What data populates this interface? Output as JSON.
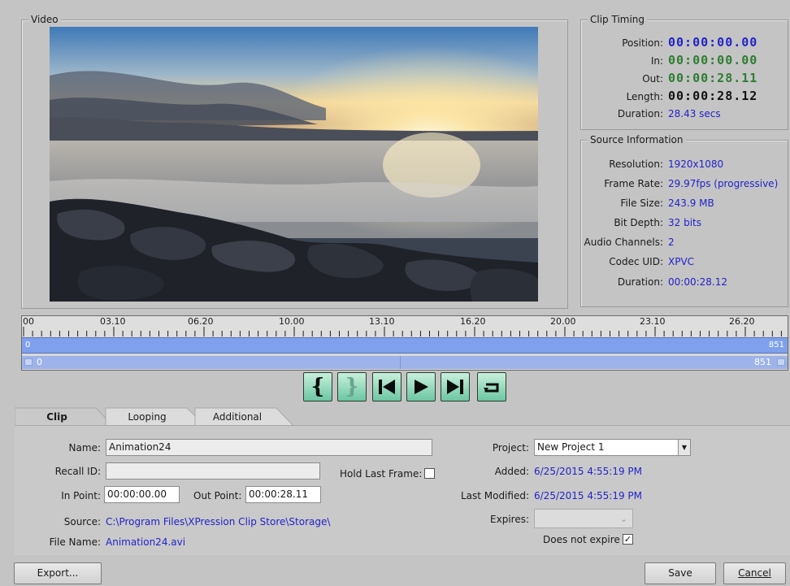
{
  "video": {
    "legend": "Video"
  },
  "clip_timing": {
    "legend": "Clip Timing",
    "position_label": "Position:",
    "position": "00:00:00.00",
    "in_label": "In:",
    "in": "00:00:00.00",
    "out_label": "Out:",
    "out": "00:00:28.11",
    "length_label": "Length:",
    "length": "00:00:28.12",
    "duration_label": "Duration:",
    "duration": "28.43 secs"
  },
  "source_info": {
    "legend": "Source Information",
    "resolution_label": "Resolution:",
    "resolution": "1920x1080",
    "frame_rate_label": "Frame Rate:",
    "frame_rate": "29.97fps (progressive)",
    "file_size_label": "File Size:",
    "file_size": "243.9 MB",
    "bit_depth_label": "Bit Depth:",
    "bit_depth": "32 bits",
    "audio_channels_label": "Audio Channels:",
    "audio_channels": "2",
    "codec_label": "Codec UID:",
    "codec": "XPVC",
    "duration_label": "Duration:",
    "duration": "00:00:28.12"
  },
  "timeline": {
    "ruler_labels": [
      "00",
      "03.10",
      "06.20",
      "10.00",
      "13.10",
      "16.20",
      "20.00",
      "23.10",
      "26.20"
    ],
    "range_start": "0",
    "range_end": "851",
    "scroll_start": "0",
    "scroll_end": "851"
  },
  "transport": {
    "set_in_glyph": "{",
    "set_out_glyph": "}"
  },
  "tabs": [
    "Clip",
    "Looping",
    "Additional"
  ],
  "clip": {
    "name_label": "Name:",
    "name": "Animation24",
    "recall_id_label": "Recall ID:",
    "recall_id": "",
    "hold_last_frame_label": "Hold Last Frame:",
    "in_point_label": "In Point:",
    "in_point": "00:00:00.00",
    "out_point_label": "Out Point:",
    "out_point": "00:00:28.11",
    "source_label": "Source:",
    "source": "C:\\Program Files\\XPression Clip Store\\Storage\\",
    "file_name_label": "File Name:",
    "file_name": "Animation24.avi",
    "project_label": "Project:",
    "project": "New Project 1",
    "added_label": "Added:",
    "added": "6/25/2015 4:55:19 PM",
    "last_modified_label": "Last Modified:",
    "last_modified": "6/25/2015 4:55:19 PM",
    "expires_label": "Expires:",
    "expires": "",
    "does_not_expire_label": "Does not expire",
    "does_not_expire": true
  },
  "buttons": {
    "export": "Export...",
    "save": "Save",
    "cancel": "Cancel"
  },
  "colors": {
    "accent_blue": "#2222cc",
    "timecode_green": "#2e7d32",
    "timeline_blue": "#7fa0ec",
    "transport_green": "#6cc6a3"
  }
}
